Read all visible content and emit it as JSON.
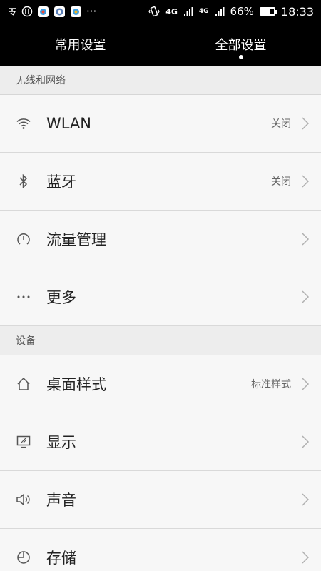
{
  "status_bar": {
    "left_icons": [
      "input-method-icon",
      "notification-icon",
      "app-icon-1",
      "app-icon-2",
      "app-icon-3"
    ],
    "more": "···",
    "network_1": "4G",
    "network_2": "4G",
    "battery_percent": "66%",
    "battery_level": 0.66,
    "time": "18:33"
  },
  "tabs": [
    {
      "label": "常用设置",
      "active": false
    },
    {
      "label": "全部设置",
      "active": true
    }
  ],
  "sections": [
    {
      "header": "无线和网络",
      "items": [
        {
          "label": "WLAN",
          "value": "关闭",
          "icon": "wifi-icon"
        },
        {
          "label": "蓝牙",
          "value": "关闭",
          "icon": "bluetooth-icon"
        },
        {
          "label": "流量管理",
          "value": "",
          "icon": "data-usage-icon"
        },
        {
          "label": "更多",
          "value": "",
          "icon": "more-icon"
        }
      ]
    },
    {
      "header": "设备",
      "items": [
        {
          "label": "桌面样式",
          "value": "标准样式",
          "icon": "home-icon"
        },
        {
          "label": "显示",
          "value": "",
          "icon": "display-icon"
        },
        {
          "label": "声音",
          "value": "",
          "icon": "sound-icon"
        },
        {
          "label": "存储",
          "value": "",
          "icon": "storage-icon"
        }
      ]
    }
  ]
}
